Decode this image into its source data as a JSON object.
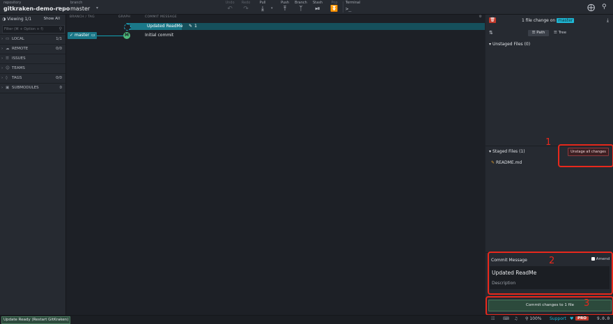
{
  "toolbar": {
    "repo_label": "repository",
    "repo_name": "gitkraken-demo-repo",
    "branch_label": "branch",
    "branch_name": "master",
    "undo": "Undo",
    "redo": "Redo",
    "pull": "Pull",
    "push": "Push",
    "branch": "Branch",
    "stash": "Stash",
    "pop": "Pop",
    "terminal": "Terminal",
    "terminal_prompt": ">_"
  },
  "sidebar": {
    "viewing": "Viewing 1/1",
    "show_all": "Show All",
    "filter_placeholder": "Filter (⌘ + Option + f)",
    "sections": [
      {
        "label": "LOCAL",
        "count": "1/1"
      },
      {
        "label": "REMOTE",
        "count": "0/0"
      },
      {
        "label": "ISSUES",
        "count": ""
      },
      {
        "label": "TEAMS",
        "count": ""
      },
      {
        "label": "TAGS",
        "count": "0/0"
      },
      {
        "label": "SUBMODULES",
        "count": "0"
      }
    ]
  },
  "graph": {
    "col_branch": "BRANCH / TAG",
    "col_graph": "GRAPH",
    "col_message": "COMMIT MESSAGE",
    "wip_message": "Updated ReadMe",
    "wip_count": "1",
    "branch_tag": "master",
    "commit_message": "Initial commit",
    "avatar": "M"
  },
  "right": {
    "summary": "1 file change on",
    "branch_badge": "master",
    "path_btn": "Path",
    "tree_btn": "Tree",
    "unstaged": "Unstaged Files (0)",
    "staged": "Staged Files (1)",
    "unstage_all": "Unstage all changes",
    "staged_file": "README.md",
    "commit_label": "Commit Message",
    "amend": "Amend",
    "commit_summary": "Updated ReadMe",
    "description": "Description",
    "commit_button": "Commit changes to 1 file"
  },
  "annotations": [
    "1",
    "2",
    "3"
  ],
  "statusbar": {
    "update": "Update Ready (Restart GitKraken)",
    "zoom": "100%",
    "support": "Support",
    "pro": "PRO",
    "version": "9.0.0"
  },
  "colors": {
    "accent": "#1fb8d6",
    "graph_line": "#12a3b5",
    "node": "#4eb87a",
    "commit_btn": "#2c4a3c",
    "annotation": "#e8281c"
  }
}
